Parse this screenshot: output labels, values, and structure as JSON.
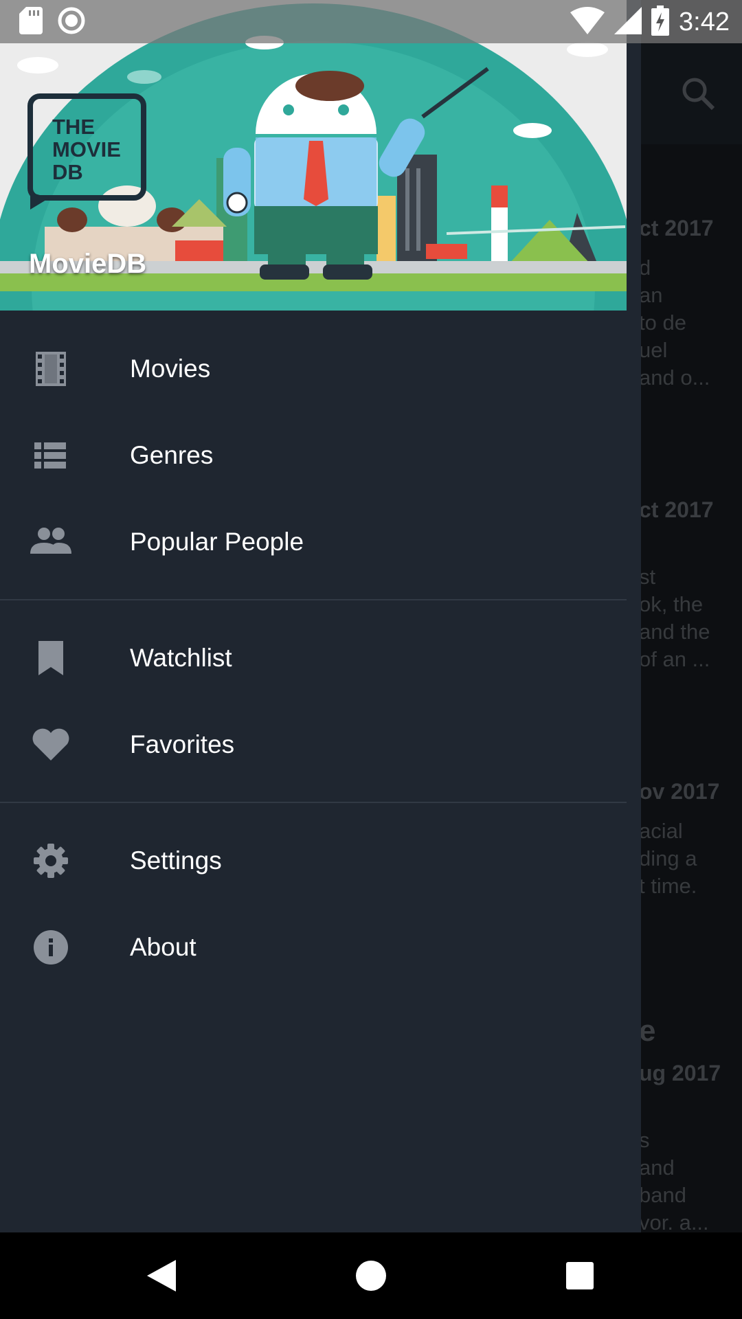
{
  "status_bar": {
    "time": "3:42",
    "icons": [
      "sd-card-icon",
      "record-icon",
      "wifi-icon",
      "signal-icon",
      "battery-charging-icon"
    ]
  },
  "header": {
    "logo_lines": [
      "THE",
      "MOVIE",
      "DB"
    ],
    "app_name": "MovieDB"
  },
  "menu": {
    "groups": [
      [
        {
          "label": "Movies",
          "icon": "movie-icon"
        },
        {
          "label": "Genres",
          "icon": "list-icon"
        },
        {
          "label": "Popular People",
          "icon": "people-icon"
        }
      ],
      [
        {
          "label": "Watchlist",
          "icon": "bookmark-icon"
        },
        {
          "label": "Favorites",
          "icon": "heart-icon"
        }
      ],
      [
        {
          "label": "Settings",
          "icon": "gear-icon"
        },
        {
          "label": "About",
          "icon": "info-icon"
        }
      ]
    ]
  },
  "background": {
    "cards": [
      {
        "date": "ct 2017",
        "lines": [
          "d",
          "an",
          "to de",
          "uel",
          "and o..."
        ]
      },
      {
        "date": "ct 2017",
        "lines": [
          "st",
          "ok, the",
          "and the",
          "of an ..."
        ]
      },
      {
        "date": "ov 2017",
        "lines": [
          "acial",
          "ding a",
          "t time."
        ]
      },
      {
        "title": "e",
        "date": "ug 2017",
        "lines": [
          "s",
          " and",
          "band",
          "vor. a..."
        ]
      }
    ]
  },
  "colors": {
    "drawer_bg": "#1f2630",
    "header_teal": "#2fa89a",
    "text": "#ffffff",
    "icon": "#8a9099"
  }
}
